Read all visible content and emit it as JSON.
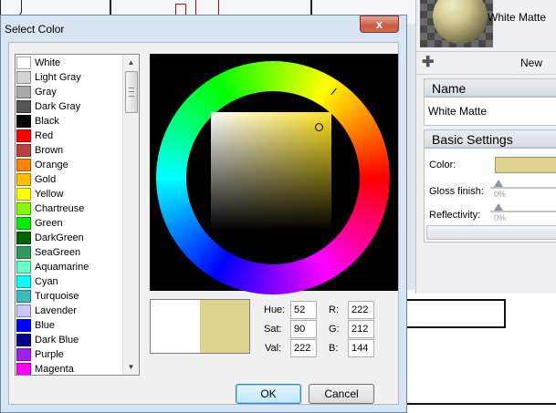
{
  "dialog": {
    "title": "Select Color",
    "close_glyph": "x",
    "colors": [
      {
        "name": "White",
        "hex": "#ffffff"
      },
      {
        "name": "Light Gray",
        "hex": "#d3d3d3"
      },
      {
        "name": "Gray",
        "hex": "#a9a9a9"
      },
      {
        "name": "Dark Gray",
        "hex": "#555555"
      },
      {
        "name": "Black",
        "hex": "#000000"
      },
      {
        "name": "Red",
        "hex": "#ff0000"
      },
      {
        "name": "Brown",
        "hex": "#b5443f"
      },
      {
        "name": "Orange",
        "hex": "#ff8400"
      },
      {
        "name": "Gold",
        "hex": "#ffbf00"
      },
      {
        "name": "Yellow",
        "hex": "#ffff00"
      },
      {
        "name": "Chartreuse",
        "hex": "#7fff00"
      },
      {
        "name": "Green",
        "hex": "#00ee00"
      },
      {
        "name": "DarkGreen",
        "hex": "#006400"
      },
      {
        "name": "SeaGreen",
        "hex": "#2e9a5c"
      },
      {
        "name": "Aquamarine",
        "hex": "#66ffc4"
      },
      {
        "name": "Cyan",
        "hex": "#00ffff"
      },
      {
        "name": "Turquoise",
        "hex": "#3cbcbc"
      },
      {
        "name": "Lavender",
        "hex": "#c8c8ff"
      },
      {
        "name": "Blue",
        "hex": "#0000ff"
      },
      {
        "name": "Dark Blue",
        "hex": "#00008b"
      },
      {
        "name": "Purple",
        "hex": "#a020f0"
      },
      {
        "name": "Magenta",
        "hex": "#ff00ff"
      }
    ],
    "hsv": {
      "hue_label": "Hue:",
      "hue": "52",
      "sat_label": "Sat:",
      "sat": "90",
      "val_label": "Val:",
      "val": "222"
    },
    "rgb": {
      "r_label": "R:",
      "r": "222",
      "g_label": "G:",
      "g": "212",
      "b_label": "B:",
      "b": "144"
    },
    "old_color": "#ffffff",
    "new_color": "#ded490",
    "ok_label": "OK",
    "cancel_label": "Cancel",
    "scroll_up_glyph": "▲",
    "scroll_down_glyph": "▼"
  },
  "material_panel": {
    "material_name": "White Matte",
    "new_label": "New",
    "add_icon_glyph": "✚",
    "name_header": "Name",
    "name_value": "White Matte",
    "settings_header": "Basic Settings",
    "color_label": "Color:",
    "color_value": "#ded490",
    "gloss_label": "Gloss finish:",
    "gloss_value": "0%",
    "reflectivity_label": "Reflectivity:",
    "reflectivity_value": "0%"
  }
}
